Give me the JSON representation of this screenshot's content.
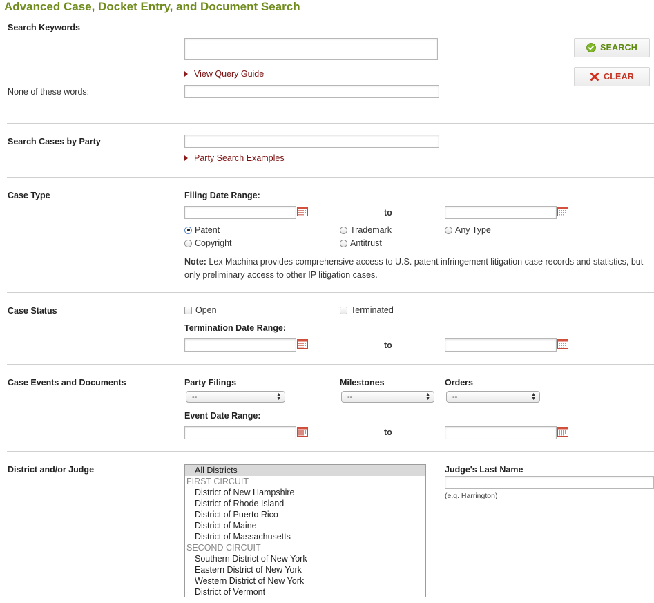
{
  "page": {
    "title": "Advanced Case, Docket Entry, and Document Search"
  },
  "keywords": {
    "label": "Search Keywords",
    "value": "",
    "query_guide_link": "View Query Guide",
    "none_words_label": "None of these words:",
    "none_words_value": ""
  },
  "buttons": {
    "search": "SEARCH",
    "clear": "CLEAR"
  },
  "party": {
    "label": "Search Cases by Party",
    "value": "",
    "examples_link": "Party Search Examples"
  },
  "case_type": {
    "label": "Case Type",
    "filing_range_label": "Filing Date Range:",
    "to": "to",
    "options": [
      {
        "label": "Patent",
        "checked": true
      },
      {
        "label": "Trademark",
        "checked": false
      },
      {
        "label": "Any Type",
        "checked": false
      },
      {
        "label": "Copyright",
        "checked": false
      },
      {
        "label": "Antitrust",
        "checked": false
      }
    ],
    "note_bold": "Note:",
    "note_text": " Lex Machina provides comprehensive access to U.S. patent infringement litigation case records and statistics, but only preliminary access to other IP litigation cases."
  },
  "case_status": {
    "label": "Case Status",
    "open": "Open",
    "terminated": "Terminated",
    "termination_range_label": "Termination Date Range:",
    "to": "to"
  },
  "events": {
    "label": "Case Events and Documents",
    "party_filings_label": "Party Filings",
    "party_filings_value": "--",
    "milestones_label": "Milestones",
    "milestones_value": "--",
    "orders_label": "Orders",
    "orders_value": "--",
    "event_range_label": "Event Date Range:",
    "to": "to"
  },
  "district": {
    "label": "District and/or Judge",
    "list": [
      {
        "type": "option",
        "label": "All Districts",
        "selected": true
      },
      {
        "type": "group",
        "label": "FIRST CIRCUIT"
      },
      {
        "type": "option",
        "label": "District of New Hampshire"
      },
      {
        "type": "option",
        "label": "District of Rhode Island"
      },
      {
        "type": "option",
        "label": "District of Puerto Rico"
      },
      {
        "type": "option",
        "label": "District of Maine"
      },
      {
        "type": "option",
        "label": "District of Massachusetts"
      },
      {
        "type": "group",
        "label": "SECOND CIRCUIT"
      },
      {
        "type": "option",
        "label": "Southern District of New York"
      },
      {
        "type": "option",
        "label": "Eastern District of New York"
      },
      {
        "type": "option",
        "label": "Western District of New York"
      },
      {
        "type": "option",
        "label": "District of Vermont"
      }
    ],
    "judge_label": "Judge's Last Name",
    "judge_value": "",
    "judge_hint": "(e.g. Harrington)"
  },
  "colors": {
    "title_green": "#6f8c1c",
    "link_red": "#7a1010",
    "search_green": "#5f8a12",
    "clear_red": "#c53324"
  }
}
